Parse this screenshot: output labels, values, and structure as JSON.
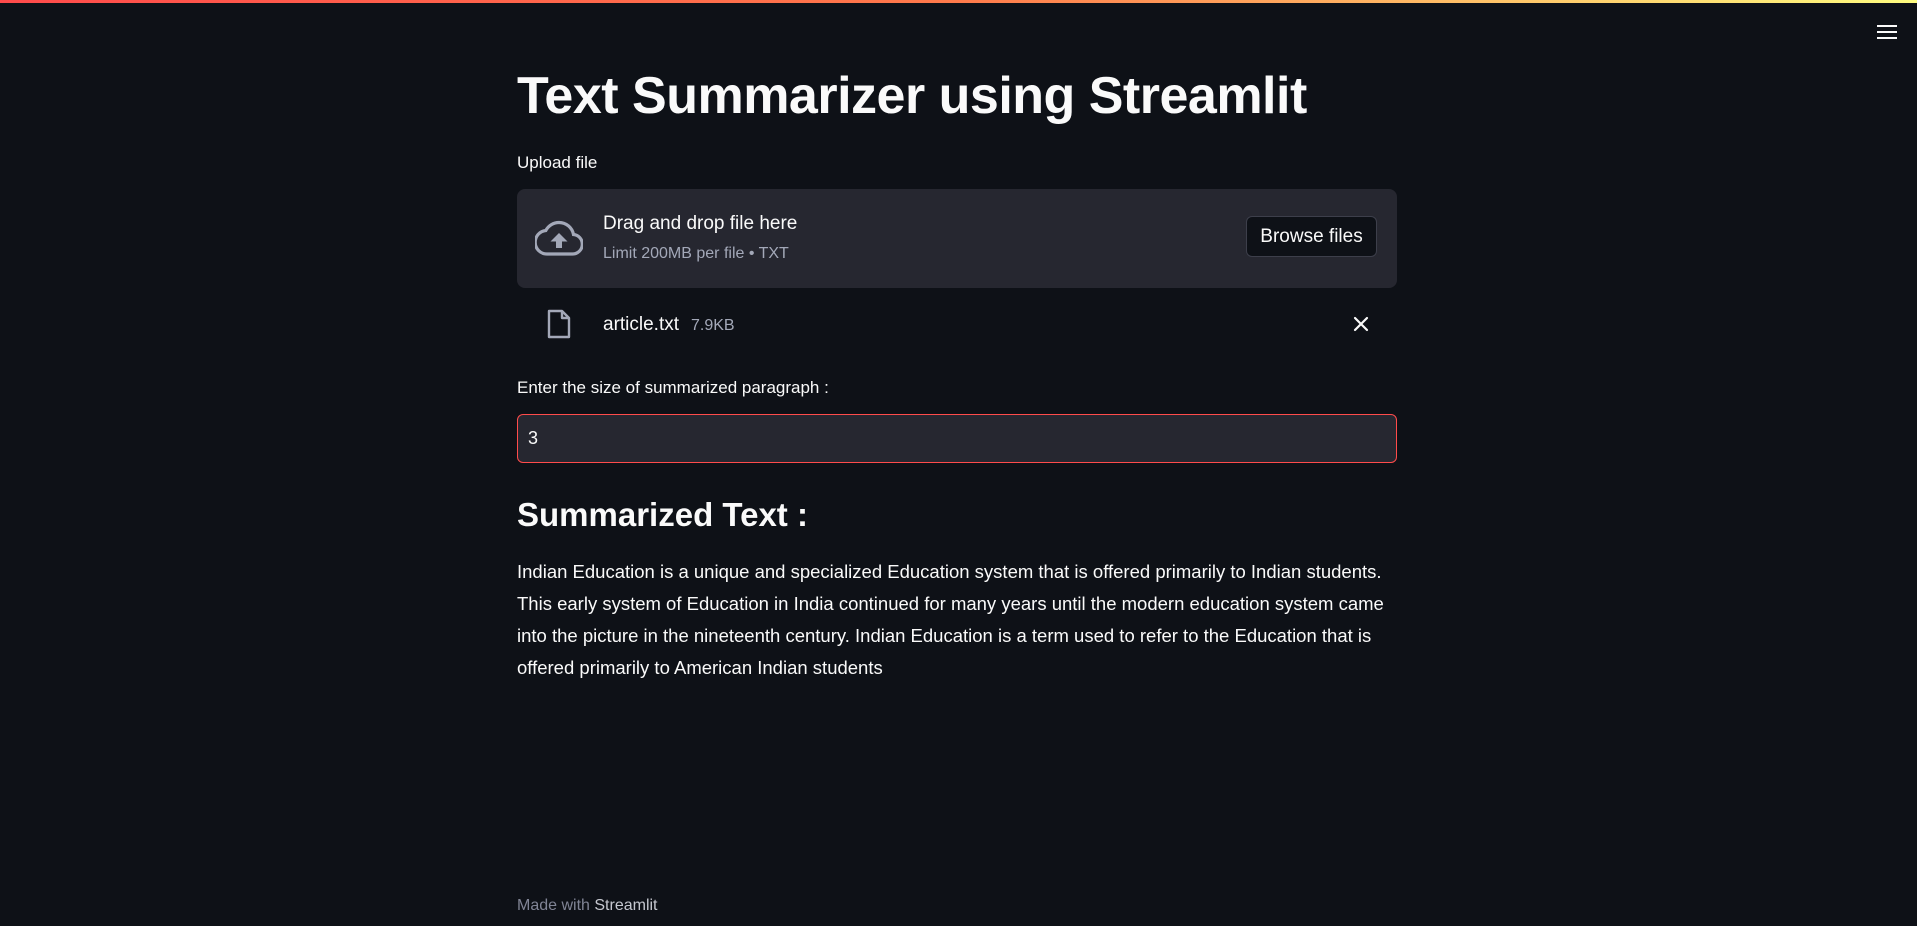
{
  "app": {
    "title": "Text Summarizer using Streamlit"
  },
  "colors": {
    "background": "#0e1117",
    "widget_background": "#262730",
    "primary": "#ff4b4b",
    "text": "#fafafa",
    "muted_text": "#a3a8b8"
  },
  "icons": {
    "menu": "hamburger-menu-icon",
    "upload": "cloud-upload-icon",
    "file": "file-icon",
    "remove": "close-icon"
  },
  "uploader": {
    "label": "Upload file",
    "drop_text": "Drag and drop file here",
    "limit_text": "Limit 200MB per file • TXT",
    "browse_label": "Browse files",
    "file": {
      "name": "article.txt",
      "size": "7.9KB"
    }
  },
  "size_input": {
    "label": "Enter the size of summarized paragraph :",
    "value": "3"
  },
  "summary": {
    "heading": "Summarized Text :",
    "text": "Indian Education is a unique and specialized Education system that is offered primarily to Indian students. This early system of Education in India continued for many years until the modern education system came into the picture in the nineteenth century. Indian Education is a term used to refer to the Education that is offered primarily to American Indian students"
  },
  "footer": {
    "prefix": "Made with",
    "brand": "Streamlit"
  }
}
